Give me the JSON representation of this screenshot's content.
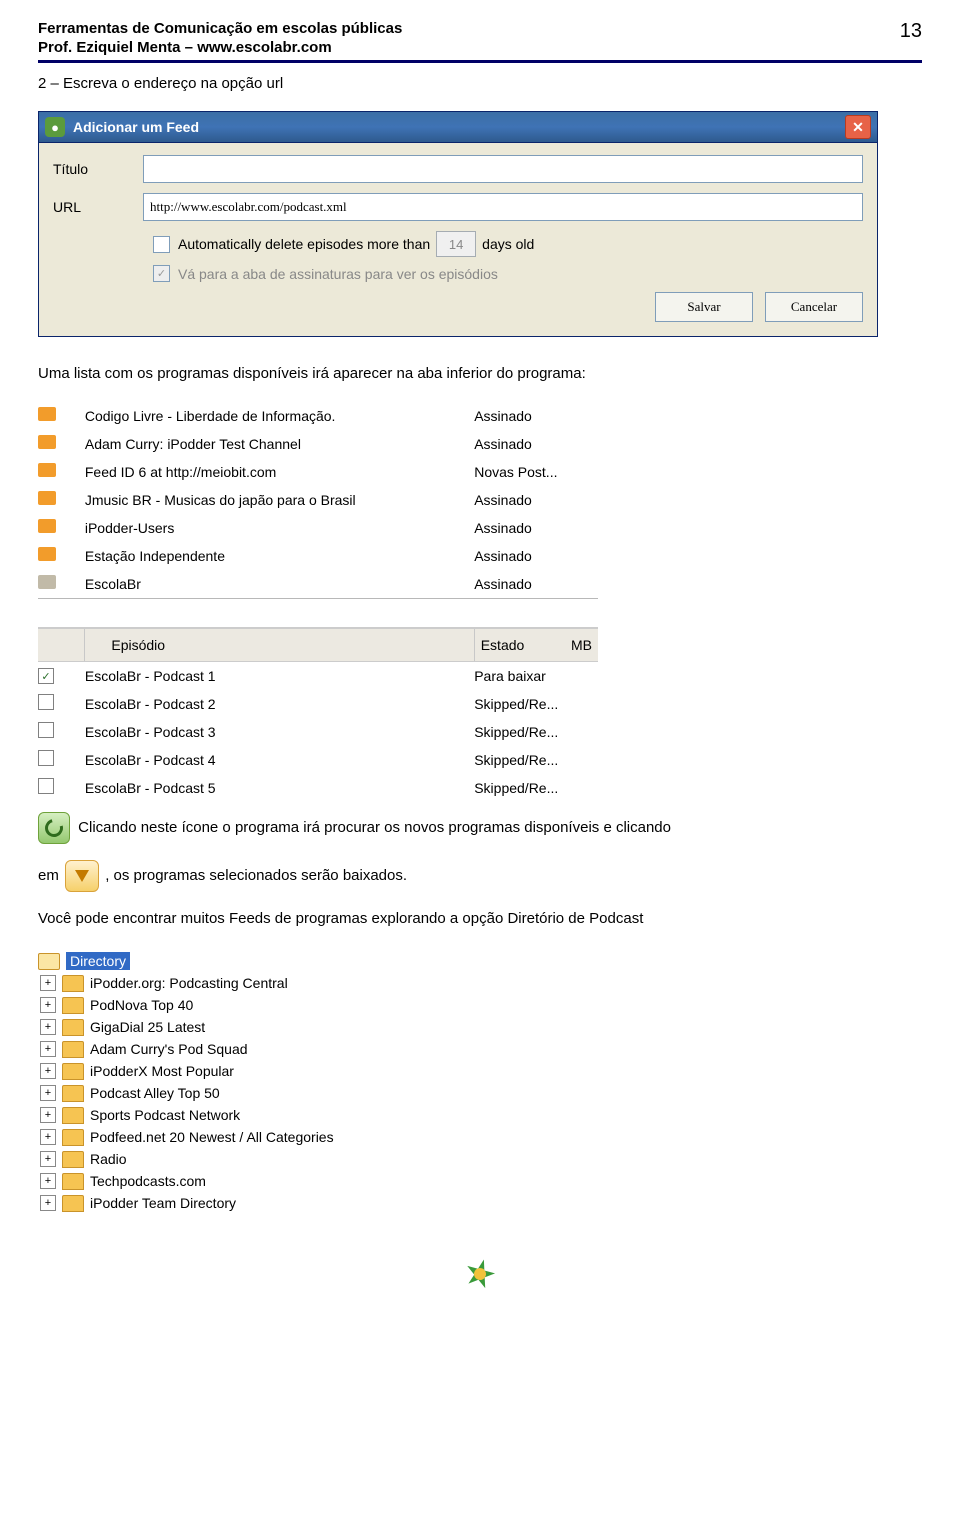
{
  "header": {
    "title": "Ferramentas de Comunicação em escolas públicas",
    "sub": "Prof. Eziquiel Menta – www.escolabr.com",
    "page": "13"
  },
  "text": {
    "step2": "2 – Escreva o endereço na opção url",
    "listIntro": "Uma lista com os programas disponíveis irá aparecer na aba inferior do programa:",
    "scan": " Clicando neste ícone o programa irá procurar os novos programas disponíveis e clicando",
    "emPrefix": "em  ",
    "dlSuffix": " , os programas selecionados serão baixados.",
    "feedsDir": "Você pode encontrar muitos Feeds de programas explorando a opção Diretório de Podcast"
  },
  "dialog": {
    "title": "Adicionar um Feed",
    "labelTitulo": "Título",
    "labelURL": "URL",
    "urlValue": "http://www.escolabr.com/podcast.xml",
    "autoDeletePre": "Automatically delete episodes more than",
    "daysValue": "14",
    "autoDeletePost": "days old",
    "gotoSubs": "Vá para a aba de assinaturas para ver os episódios",
    "save": "Salvar",
    "cancel": "Cancelar"
  },
  "feeds": [
    {
      "name": "Codigo Livre - Liberdade de Informação.",
      "state": "Assinado",
      "sel": false
    },
    {
      "name": "Adam Curry: iPodder Test Channel",
      "state": "Assinado",
      "sel": false
    },
    {
      "name": "Feed ID 6 at http://meiobit.com",
      "state": "Novas Post...",
      "sel": false
    },
    {
      "name": "Jmusic BR - Musicas do japão para o Brasil",
      "state": "Assinado",
      "sel": false
    },
    {
      "name": "iPodder-Users",
      "state": "Assinado",
      "sel": false
    },
    {
      "name": "Estação Independente",
      "state": "Assinado",
      "sel": false
    },
    {
      "name": "EscolaBr",
      "state": "Assinado",
      "sel": true
    }
  ],
  "epHeaders": {
    "c1": "Episódio",
    "c2": "Estado",
    "c3": "MB"
  },
  "episodes": [
    {
      "name": "EscolaBr - Podcast 1",
      "state": "Para baixar",
      "chk": true
    },
    {
      "name": "EscolaBr - Podcast 2",
      "state": "Skipped/Re...",
      "chk": false
    },
    {
      "name": "EscolaBr - Podcast 3",
      "state": "Skipped/Re...",
      "chk": false
    },
    {
      "name": "EscolaBr - Podcast 4",
      "state": "Skipped/Re...",
      "chk": false
    },
    {
      "name": "EscolaBr - Podcast 5",
      "state": "Skipped/Re...",
      "chk": false
    }
  ],
  "directory": {
    "root": "Directory",
    "items": [
      "iPodder.org: Podcasting Central",
      "PodNova Top 40",
      "GigaDial 25 Latest",
      "Adam Curry's Pod Squad",
      "iPodderX Most Popular",
      "Podcast Alley Top 50",
      "Sports Podcast Network",
      "Podfeed.net 20 Newest / All Categories",
      "Radio",
      "Techpodcasts.com",
      "iPodder Team Directory"
    ]
  }
}
